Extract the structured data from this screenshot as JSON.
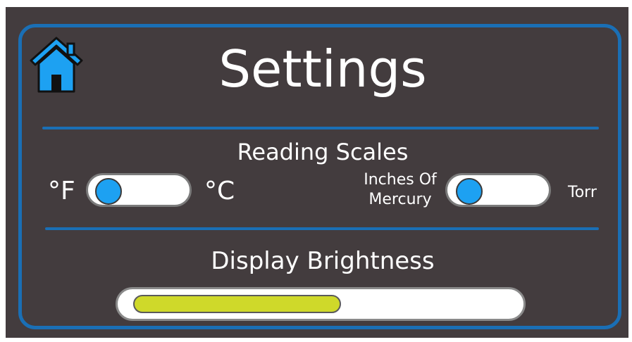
{
  "header": {
    "title": "Settings",
    "home_icon": "home-icon"
  },
  "reading_scales": {
    "label": "Reading Scales",
    "temperature": {
      "left_label": "°F",
      "right_label": "°C",
      "selected": "°F"
    },
    "pressure": {
      "left_label_line1": "Inches Of",
      "left_label_line2": "Mercury",
      "right_label": "Torr",
      "selected": "Inches Of Mercury"
    }
  },
  "display_brightness": {
    "label": "Display Brightness",
    "level_fraction": 0.55
  },
  "colors": {
    "background": "#433c3e",
    "accent_blue": "#1a6fb5",
    "knob_blue": "#1da1f2",
    "brightness_fill": "#cfd92a",
    "text": "#ffffff"
  }
}
